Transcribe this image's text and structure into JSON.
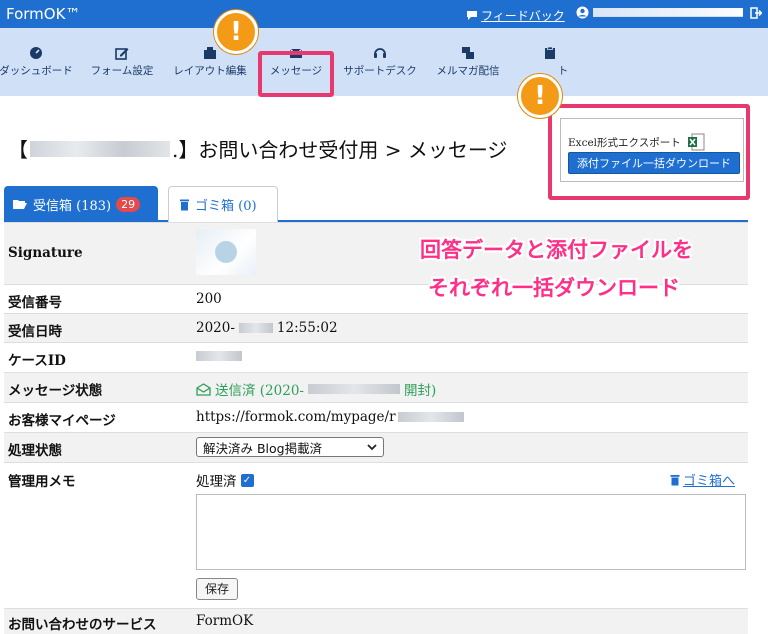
{
  "app": {
    "brand": "FormOK™",
    "feedback_label": "フィードバック"
  },
  "nav": {
    "items": [
      {
        "label": "ダッシュボード",
        "icon": "dashboard-icon"
      },
      {
        "label": "フォーム設定",
        "icon": "edit-icon"
      },
      {
        "label": "レイアウト編集",
        "icon": "layout-icon"
      },
      {
        "label": "メッセージ",
        "icon": "envelope-icon"
      },
      {
        "label": "サポートデスク",
        "icon": "headset-icon"
      },
      {
        "label": "メルマガ配信",
        "icon": "newsletter-icon"
      },
      {
        "label": "ト",
        "icon": "clipboard-icon"
      }
    ]
  },
  "page": {
    "title_open": "【",
    "title_rest": ".】お問い合わせ受付用 > メッセージ"
  },
  "export": {
    "excel_label": "Excel形式エクスポート",
    "download_label": "添付ファイル一括ダウンロード"
  },
  "tabs": {
    "inbox_label": "受信箱 (183)",
    "inbox_badge": "29",
    "trash_label": "ゴミ箱 (0)"
  },
  "details": {
    "signature_label": "Signature",
    "receipt_no_label": "受信番号",
    "receipt_no": "200",
    "received_at_label": "受信日時",
    "received_at_prefix": "2020-",
    "received_at_time": "12:55:02",
    "case_id_label": "ケースID",
    "message_status_label": "メッセージ状態",
    "message_status_prefix": "送信済 (2020-",
    "message_status_suffix": "開封)",
    "mypage_label": "お客様マイページ",
    "mypage_url": "https://formok.com/mypage/r",
    "process_status_label": "処理状態",
    "process_status_value": "解決済み Blog掲載済",
    "memo_label": "管理用メモ",
    "memo_value": "処理済",
    "trash_link": "ゴミ箱へ",
    "save_button": "保存",
    "service_label": "お問い合わせのサービス",
    "service_value": "FormOK"
  },
  "annotation": {
    "line1": "回答データと添付ファイルを",
    "line2": "それぞれ一括ダウンロード"
  },
  "colors": {
    "primary": "#1f6fd1",
    "nav_bg": "#cfe0f7",
    "highlight": "#e8396e",
    "warning": "#f39a16",
    "annotation": "#ff2f87",
    "badge": "#e34b4b"
  }
}
